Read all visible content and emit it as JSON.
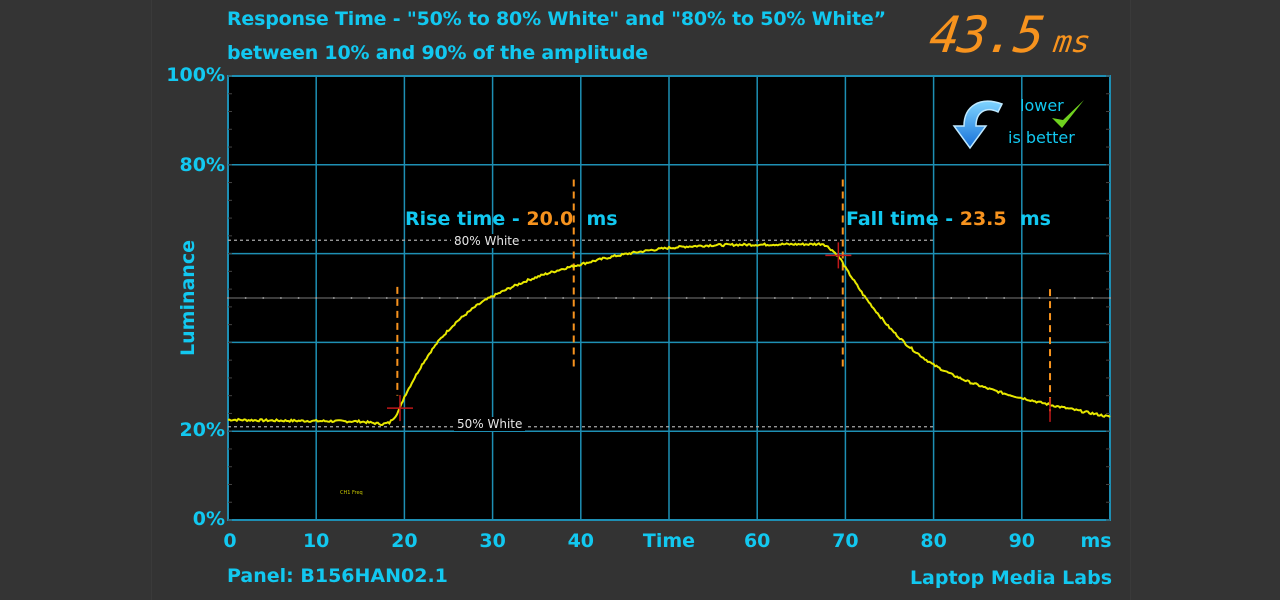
{
  "header": {
    "title_line1": "Response Time - \"50% to 80% White\" and \"80% to 50% White”",
    "title_line2": "between 10% and 90% of the amplitude",
    "total_value": "43.5",
    "total_unit": "ms"
  },
  "badge": {
    "line1": "lower",
    "line2": "is better",
    "arrow_icon": "down-arrow-icon",
    "check_icon": "checkmark-icon"
  },
  "footer": {
    "panel": "Panel: B156HAN02.1",
    "credit": "Laptop Media Labs"
  },
  "colors": {
    "accent": "#12c8f0",
    "value": "#f7931e",
    "trace": "#e8e800",
    "grid": "#1e8fb4",
    "marker": "#c0181a",
    "background": "#333333",
    "plot_bg": "#000000"
  },
  "chart_data": {
    "type": "line",
    "title": "Response Time - \"50% to 80% White\" and \"80% to 50% White” between 10% and 90% of the amplitude",
    "xlabel": "Time",
    "xunit": "ms",
    "ylabel": "Luminance",
    "xlim": [
      0,
      100
    ],
    "ylim": [
      0,
      100
    ],
    "grid": true,
    "x_ticks": [
      "0",
      "10",
      "20",
      "30",
      "40",
      "Time",
      "60",
      "70",
      "80",
      "90",
      "ms"
    ],
    "x_tick_values": [
      0,
      10,
      20,
      30,
      40,
      50,
      60,
      70,
      80,
      90,
      100
    ],
    "y_ticks": [
      {
        "label": "100%",
        "value": 100
      },
      {
        "label": "80%",
        "value": 80
      },
      {
        "label": "20%",
        "value": 20
      },
      {
        "label": "0%",
        "value": 0
      }
    ],
    "reference_lines": [
      {
        "label": "80% White",
        "value": 63
      },
      {
        "label": "50% White",
        "value": 21
      }
    ],
    "annotations": [
      {
        "label": "Rise time -",
        "value": "20.0",
        "unit": "ms"
      },
      {
        "label": "Fall time -",
        "value": "23.5",
        "unit": "ms"
      }
    ],
    "rise_markers": {
      "start": 19.2,
      "end": 39.2
    },
    "fall_markers": {
      "start": 69.7,
      "end": 93.2
    },
    "crosshairs": [
      {
        "x": 19.5,
        "y": 25.2
      },
      {
        "x": 69.2,
        "y": 59.6
      }
    ],
    "series": [
      {
        "name": "Luminance trace",
        "x": [
          0,
          5,
          10,
          15,
          17.5,
          18.3,
          19,
          19.5,
          20,
          21,
          22,
          23,
          24,
          25,
          26,
          27,
          28,
          29,
          30,
          32,
          34,
          36,
          38,
          40,
          42,
          44,
          46,
          48,
          50,
          52,
          55,
          58,
          60,
          63,
          66,
          67.5,
          68,
          68.5,
          69,
          69.5,
          70,
          71,
          72,
          73,
          74,
          75,
          76,
          77,
          78,
          79,
          80,
          82,
          84,
          86,
          88,
          90,
          92,
          94,
          96,
          98,
          100
        ],
        "y": [
          22.6,
          22.4,
          22.3,
          22.2,
          21.6,
          21.9,
          23.5,
          25.2,
          27.8,
          31.5,
          35.0,
          38.0,
          40.6,
          42.8,
          44.8,
          46.4,
          48.0,
          49.3,
          50.4,
          52.3,
          54.0,
          55.4,
          56.6,
          57.6,
          58.6,
          59.5,
          60.2,
          60.8,
          61.3,
          61.6,
          61.9,
          62.0,
          62.0,
          62.1,
          62.1,
          62.2,
          61.5,
          60.8,
          59.8,
          58.6,
          56.8,
          53.8,
          50.8,
          48.2,
          45.7,
          43.3,
          41.3,
          39.4,
          37.8,
          36.3,
          34.9,
          32.8,
          31.1,
          29.7,
          28.5,
          27.5,
          26.5,
          25.6,
          24.8,
          24.0,
          23.2
        ]
      }
    ]
  }
}
